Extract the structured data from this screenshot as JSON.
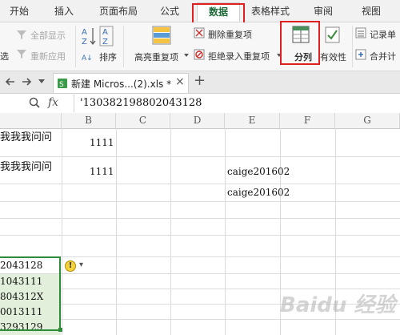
{
  "ribbon_tabs": {
    "start": "开始",
    "insert": "插入",
    "page_layout": "页面布局",
    "formula": "公式",
    "data": "数据",
    "table_style": "表格样式",
    "review": "审阅",
    "view": "视图"
  },
  "ribbon": {
    "filter_partial": "选",
    "show_all": "全部显示",
    "reapply": "重新应用",
    "sort": "排序",
    "highlight_dup": "高亮重复项",
    "remove_dup": "删除重复项",
    "reject_dup": "拒绝录入重复项",
    "split": "分列",
    "validity": "有效性",
    "record": "记录单",
    "merge_calc": "合并计"
  },
  "doc_tab": {
    "title": "新建 Micros...(2).xls *",
    "close": "×",
    "add": "+"
  },
  "formula_bar": {
    "fx": "fx",
    "value": "'130382198802043128"
  },
  "columns": [
    "B",
    "C",
    "D",
    "E",
    "F",
    "G"
  ],
  "cells": {
    "a1": "我我我问问",
    "b1": "1111",
    "a2": "我我我问问",
    "b2": "1111",
    "e2": "caige201602",
    "e3": "caige201602",
    "a_sel": [
      "2043128",
      "1043111",
      "804312X",
      "0013111",
      "3293129"
    ]
  },
  "warning_icon": "!",
  "warning_caret": "▾",
  "watermark": "Baidu 经验"
}
